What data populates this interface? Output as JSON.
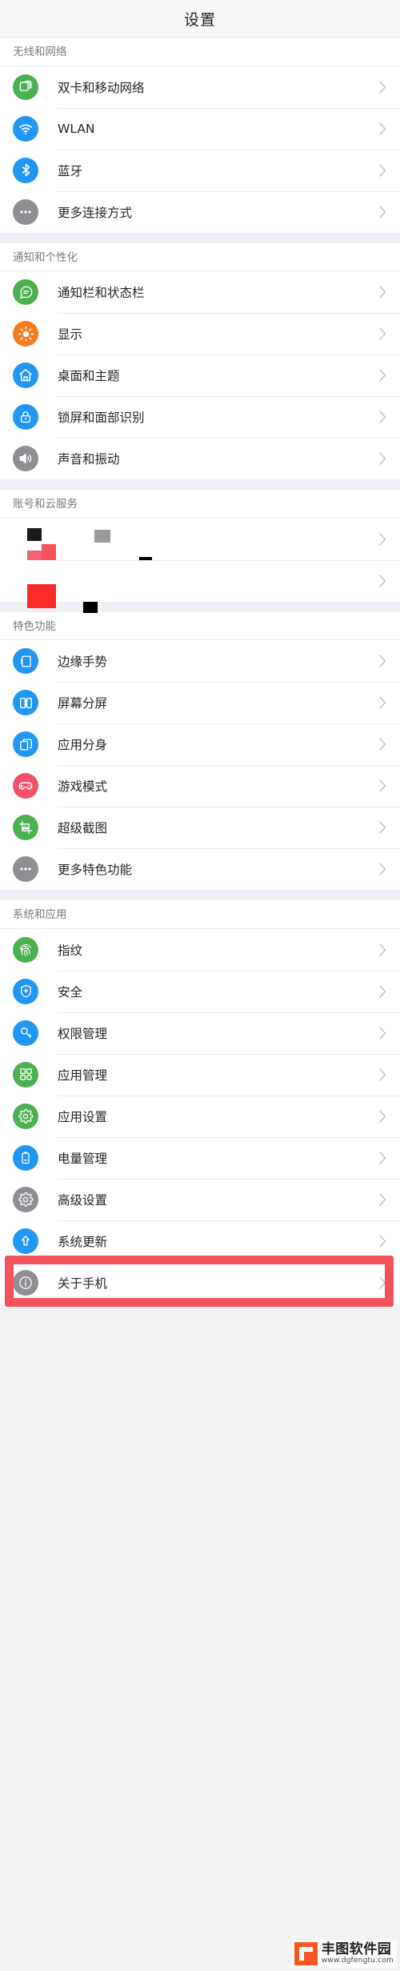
{
  "header": {
    "title": "设置"
  },
  "sections": [
    {
      "id": "wireless",
      "title": "无线和网络",
      "items": [
        {
          "label": "双卡和移动网络",
          "icon": "sim-card-icon",
          "color": "#4cb050"
        },
        {
          "label": "WLAN",
          "icon": "wifi-icon",
          "color": "#2196f3"
        },
        {
          "label": "蓝牙",
          "icon": "bluetooth-icon",
          "color": "#2196f3"
        },
        {
          "label": "更多连接方式",
          "icon": "more-dots-icon",
          "color": "#8e8e93"
        }
      ]
    },
    {
      "id": "notification",
      "title": "通知和个性化",
      "items": [
        {
          "label": "通知栏和状态栏",
          "icon": "chat-bubble-icon",
          "color": "#4cb050"
        },
        {
          "label": "显示",
          "icon": "brightness-sun-icon",
          "color": "#f57c1f"
        },
        {
          "label": "桌面和主题",
          "icon": "home-house-icon",
          "color": "#2196f3"
        },
        {
          "label": "锁屏和面部识别",
          "icon": "lock-icon",
          "color": "#2196f3"
        },
        {
          "label": "声音和振动",
          "icon": "speaker-volume-icon",
          "color": "#8e8e93"
        }
      ]
    },
    {
      "id": "account",
      "title": "账号和云服务",
      "redacted": true,
      "items": [
        {
          "label": "",
          "icon": "redacted-icon",
          "color": "#f4535c"
        },
        {
          "label": "",
          "icon": "redacted-icon",
          "color": "#fa2b2b"
        }
      ]
    },
    {
      "id": "features",
      "title": "特色功能",
      "items": [
        {
          "label": "边缘手势",
          "icon": "edge-gesture-icon",
          "color": "#2196f3"
        },
        {
          "label": "屏幕分屏",
          "icon": "split-screen-icon",
          "color": "#2196f3"
        },
        {
          "label": "应用分身",
          "icon": "app-clone-icon",
          "color": "#2196f3"
        },
        {
          "label": "游戏模式",
          "icon": "gamepad-icon",
          "color": "#f2516b"
        },
        {
          "label": "超级截图",
          "icon": "screenshot-crop-icon",
          "color": "#4cb050"
        },
        {
          "label": "更多特色功能",
          "icon": "more-dots-icon",
          "color": "#8e8e93"
        }
      ]
    },
    {
      "id": "system",
      "title": "系统和应用",
      "items": [
        {
          "label": "指纹",
          "icon": "fingerprint-icon",
          "color": "#4cb050"
        },
        {
          "label": "安全",
          "icon": "shield-plus-icon",
          "color": "#2196f3"
        },
        {
          "label": "权限管理",
          "icon": "permission-key-icon",
          "color": "#2196f3"
        },
        {
          "label": "应用管理",
          "icon": "app-manage-icon",
          "color": "#4cb050"
        },
        {
          "label": "应用设置",
          "icon": "gear-icon",
          "color": "#4cb050"
        },
        {
          "label": "电量管理",
          "icon": "battery-icon",
          "color": "#2196f3"
        },
        {
          "label": "高级设置",
          "icon": "gear-icon",
          "color": "#8e8e93"
        },
        {
          "label": "系统更新",
          "icon": "arrow-up-circle-icon",
          "color": "#2196f3"
        },
        {
          "label": "关于手机",
          "icon": "info-circle-icon",
          "color": "#8e8e93",
          "highlighted": true
        }
      ]
    }
  ],
  "highlight": {
    "color": "#f4535c"
  },
  "watermark": {
    "name": "丰图软件园",
    "url": "www.dgfengtu.com",
    "color": "#f4571f"
  }
}
